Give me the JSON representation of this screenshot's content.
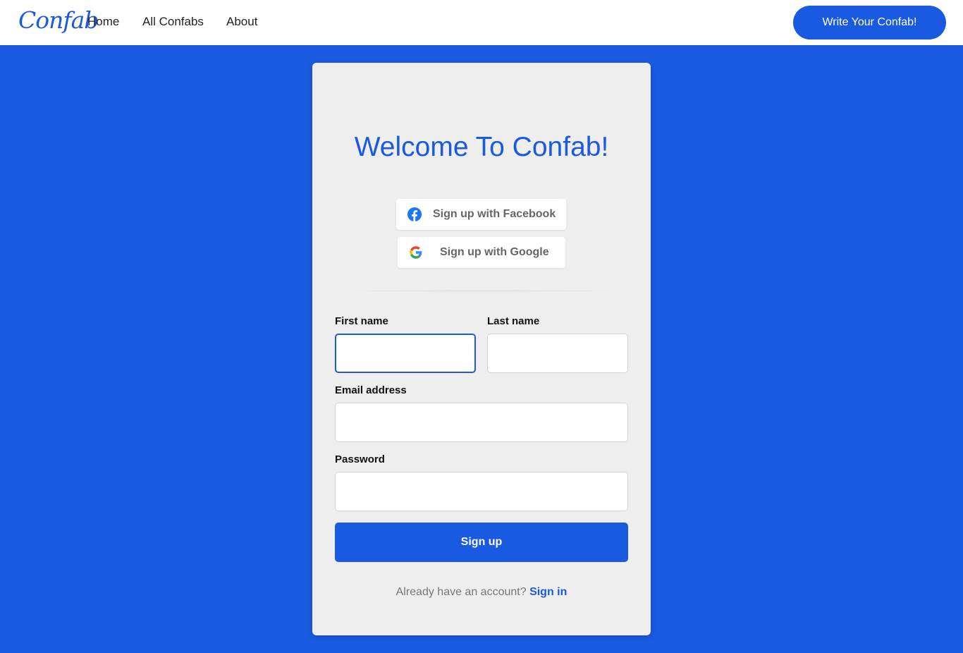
{
  "colors": {
    "accent": "#1a5ae0",
    "card_bg": "#eeeeee"
  },
  "nav": {
    "logo": "Confab",
    "links": [
      "Home",
      "All Confabs",
      "About"
    ],
    "cta": "Write Your Confab!"
  },
  "card": {
    "title": "Welcome To Confab!",
    "facebook_label": "Sign up with Facebook",
    "google_label": "Sign up with Google",
    "fields": {
      "first_name": {
        "label": "First name",
        "value": ""
      },
      "last_name": {
        "label": "Last name",
        "value": ""
      },
      "email": {
        "label": "Email address",
        "value": ""
      },
      "password": {
        "label": "Password",
        "value": ""
      }
    },
    "submit": "Sign up",
    "footer_prompt": "Already have an account?",
    "footer_link": "Sign in"
  },
  "icons": {
    "facebook": "facebook-icon",
    "google": "google-icon"
  }
}
